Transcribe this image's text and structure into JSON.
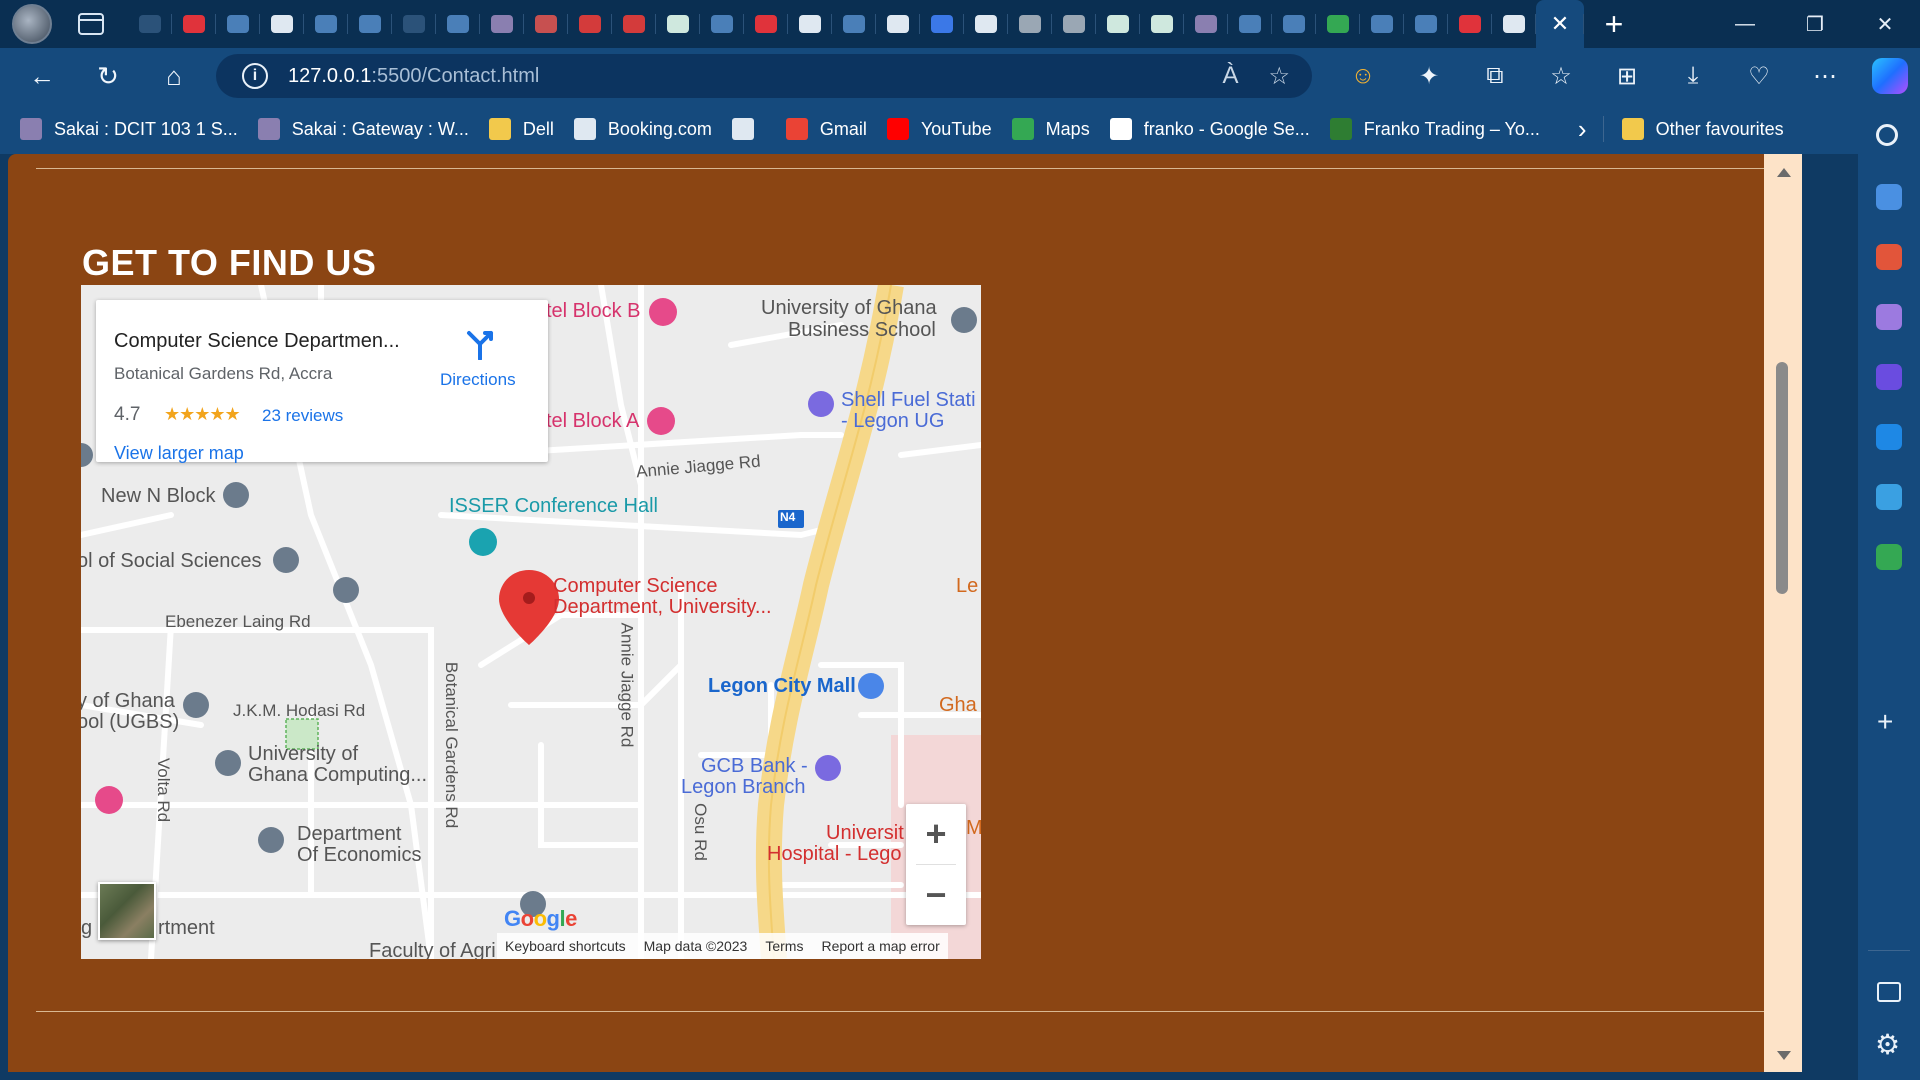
{
  "browser": {
    "url_host": "127.0.0.1",
    "url_path": ":5500/Contact.html",
    "tabs": [
      {
        "icon": "generic-tab-icon",
        "color": "#2b5279"
      },
      {
        "icon": "youtube-icon",
        "color": "#e0333b"
      },
      {
        "icon": "search-icon",
        "color": "#4a7fb8"
      },
      {
        "icon": "github-icon",
        "color": "#dfe8f1"
      },
      {
        "icon": "search-icon",
        "color": "#4a7fb8"
      },
      {
        "icon": "search-icon",
        "color": "#4a7fb8"
      },
      {
        "icon": "generic-tab-icon",
        "color": "#2b5279"
      },
      {
        "icon": "search-icon",
        "color": "#4a7fb8"
      },
      {
        "icon": "sakai-icon",
        "color": "#8a7fb0"
      },
      {
        "icon": "youtube-icon",
        "color": "#c75050"
      },
      {
        "icon": "pdf-icon",
        "color": "#d33b3b"
      },
      {
        "icon": "pdf-icon",
        "color": "#d33b3b"
      },
      {
        "icon": "chatgpt-icon",
        "color": "#cfe8de"
      },
      {
        "icon": "ellipsis-icon",
        "color": "#4a7fb8"
      },
      {
        "icon": "youtube-icon",
        "color": "#e0333b"
      },
      {
        "icon": "file-icon",
        "color": "#dfe8f1"
      },
      {
        "icon": "flag-icon",
        "color": "#4a7fb8"
      },
      {
        "icon": "github-icon",
        "color": "#dfe8f1"
      },
      {
        "icon": "docs-icon",
        "color": "#3b78e7"
      },
      {
        "icon": "github-icon",
        "color": "#dfe8f1"
      },
      {
        "icon": "github-icon",
        "color": "#9aa7b4"
      },
      {
        "icon": "github-icon",
        "color": "#9aa7b4"
      },
      {
        "icon": "chatgpt-icon",
        "color": "#cfe8de"
      },
      {
        "icon": "chatgpt-icon",
        "color": "#cfe8de"
      },
      {
        "icon": "sakai-icon",
        "color": "#8a7fb0"
      },
      {
        "icon": "ellipsis-icon",
        "color": "#4a7fb8"
      },
      {
        "icon": "search-icon",
        "color": "#4a7fb8"
      },
      {
        "icon": "maps-icon",
        "color": "#34a853"
      },
      {
        "icon": "search-icon",
        "color": "#4a7fb8"
      },
      {
        "icon": "search-icon",
        "color": "#4a7fb8"
      },
      {
        "icon": "youtube-icon",
        "color": "#e0333b"
      },
      {
        "icon": "file-icon",
        "color": "#dfe8f1"
      }
    ],
    "active_tab_close": "✕",
    "new_tab": "+",
    "window_controls": {
      "minimize": "—",
      "restore": "❐",
      "close": "✕"
    }
  },
  "toolbar": {
    "back": "←",
    "refresh": "↻",
    "home": "⌂",
    "info": "i",
    "read_aloud": "À",
    "favourite": "☆",
    "icons": [
      "☺",
      "✦",
      "⧉",
      "☆",
      "⊞",
      "⤓",
      "♡",
      "⋯"
    ]
  },
  "favorites": [
    {
      "label": "Sakai : DCIT 103 1 S...",
      "icon": "sakai-icon",
      "color": "#8a7fb0"
    },
    {
      "label": "Sakai : Gateway : W...",
      "icon": "sakai-icon",
      "color": "#8a7fb0"
    },
    {
      "label": "Dell",
      "icon": "folder-icon",
      "color": "#f2c94c"
    },
    {
      "label": "Booking.com",
      "icon": "file-icon",
      "color": "#dfe8f1"
    },
    {
      "label": "",
      "icon": "file-icon",
      "color": "#dfe8f1"
    },
    {
      "label": "Gmail",
      "icon": "gmail-icon",
      "color": "#ea4335"
    },
    {
      "label": "YouTube",
      "icon": "youtube-icon",
      "color": "#ff0000"
    },
    {
      "label": "Maps",
      "icon": "maps-icon",
      "color": "#34a853"
    },
    {
      "label": "franko - Google Se...",
      "icon": "google-icon",
      "color": "#ffffff"
    },
    {
      "label": "Franko Trading – Yo...",
      "icon": "franko-icon",
      "color": "#2e7d32"
    }
  ],
  "favorites_more": "›",
  "other_favourites": "Other favourites",
  "page": {
    "heading": "GET TO FIND US",
    "map": {
      "place_name": "Computer Science Departmen...",
      "address": "Botanical Gardens Rd, Accra",
      "rating": "4.7",
      "stars": "★★★★★",
      "reviews": "23 reviews",
      "view_larger": "View larger map",
      "directions": "Directions",
      "labels": {
        "hotel_b": "tel Block B",
        "hotel_a": "tel Block A",
        "ug_business_1": "University of Ghana",
        "ug_business_2": "Business School",
        "shell_1": "Shell Fuel Stati",
        "shell_2": "- Legon UG",
        "annie_jiagge_rd_top": "Annie Jiagge Rd",
        "new_n_block": "New N Block",
        "isser": "ISSER Conference Hall",
        "n4": "N4",
        "social_sciences": "ol of Social Sciences",
        "cs_dept_1": "Computer Science",
        "cs_dept_2": "Department, University...",
        "le": "Le",
        "ebenezer": "Ebenezer Laing Rd",
        "legon_city_mall": "Legon City Mall",
        "gha": "Gha",
        "ugbs_1": "y of Ghana",
        "ugbs_2": "ool (UGBS)",
        "jkm_hodasi": "J.K.M. Hodasi Rd",
        "ug_computing_1": "University of",
        "ug_computing_2": "Ghana Computing...",
        "botanical_rd": "Botanical Gardens Rd",
        "annie_jiagge_rd_vert": "Annie Jiagge Rd",
        "gcb_1": "GCB Bank -",
        "gcb_2": "Legon Branch",
        "volta_rd": "Volta Rd",
        "dept_econ_1": "Department",
        "dept_econ_2": "Of Economics",
        "osu_rd": "Osu Rd",
        "hospital_1": "Universit",
        "hospital_2": "Hospital - Lego",
        "my": "My",
        "artment": "rtment",
        "g_left": "g",
        "faculty": "Faculty of Agri"
      },
      "zoom_in": "+",
      "zoom_out": "−",
      "google": "Google",
      "footer": {
        "shortcuts": "Keyboard shortcuts",
        "map_data": "Map data ©2023",
        "terms": "Terms",
        "report": "Report a map error"
      }
    }
  },
  "sidebar": {
    "icons": [
      {
        "name": "search-icon",
        "color": "#e9f1f9"
      },
      {
        "name": "tag-icon",
        "color": "#4a90e2"
      },
      {
        "name": "toolbox-icon",
        "color": "#e2553a"
      },
      {
        "name": "chess-icon",
        "color": "#9c7ae0"
      },
      {
        "name": "office-icon",
        "color": "#6a4ce0"
      },
      {
        "name": "outlook-icon",
        "color": "#1e88e5"
      },
      {
        "name": "send-icon",
        "color": "#3aa0e2"
      },
      {
        "name": "tree-icon",
        "color": "#34a853"
      }
    ],
    "add": "+",
    "settings": "⚙"
  },
  "colors": {
    "page_bg": "#8b4513",
    "heading": "#ffffff",
    "browser_frame": "#154a7d"
  }
}
